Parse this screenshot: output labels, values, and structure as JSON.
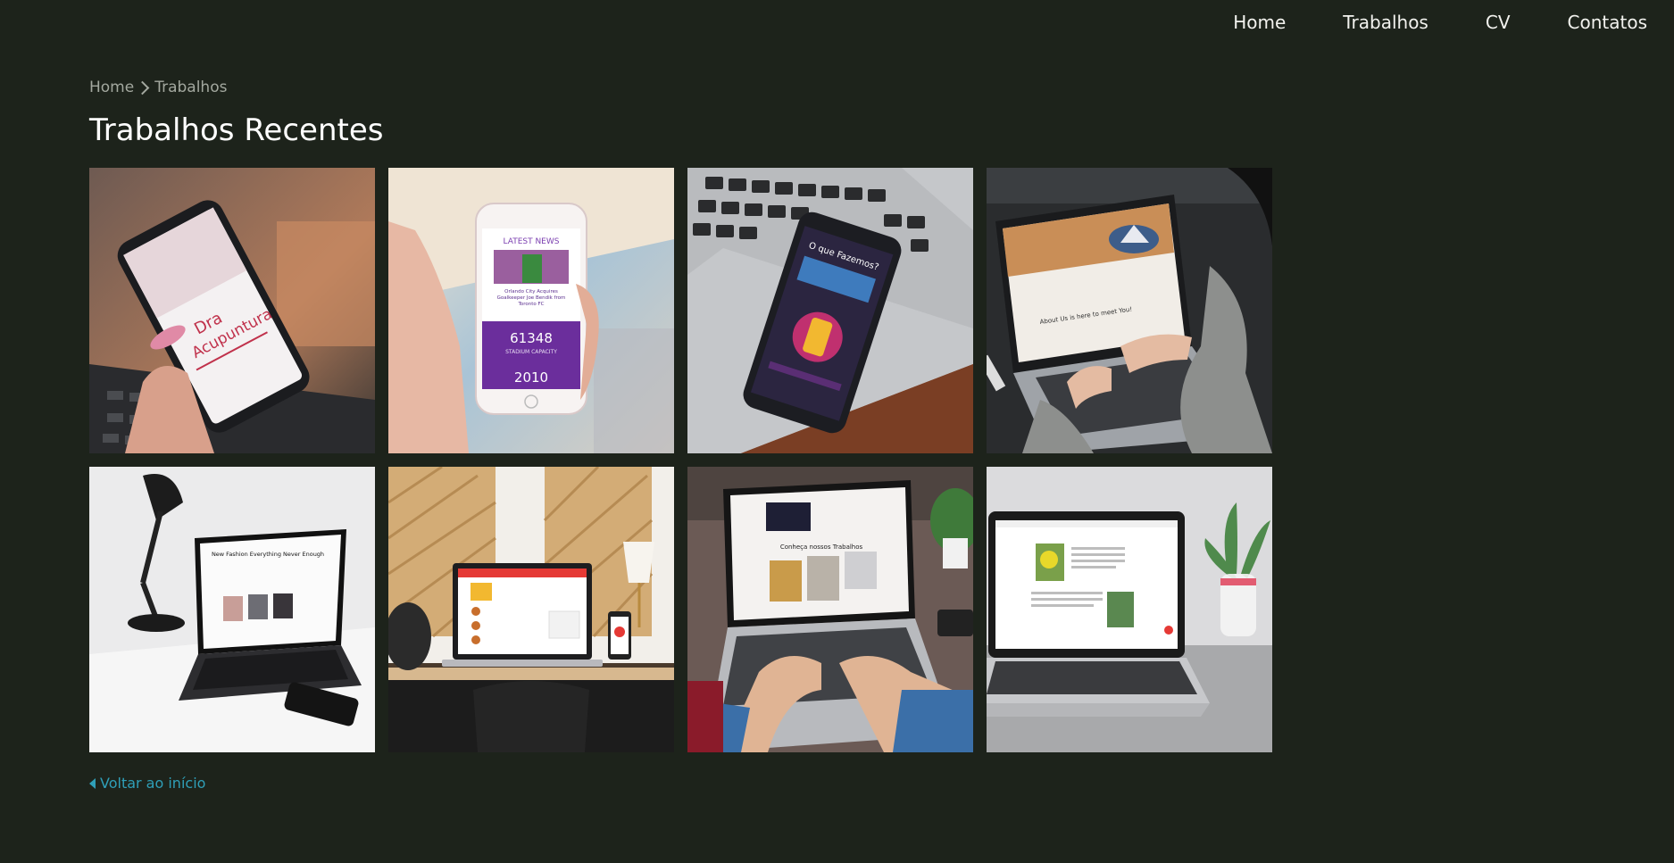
{
  "nav": {
    "items": [
      {
        "label": "Home"
      },
      {
        "label": "Trabalhos"
      },
      {
        "label": "CV"
      },
      {
        "label": "Contatos"
      }
    ]
  },
  "breadcrumb": {
    "home": "Home",
    "current": "Trabalhos"
  },
  "page": {
    "title": "Trabalhos Recentes",
    "back_link": "Voltar ao início"
  },
  "gallery": {
    "tile1": {
      "screen_text_1": "Dra",
      "screen_text_2": "Acupuntura"
    },
    "tile2": {
      "header": "LATEST NEWS",
      "headline_1": "Orlando City Acquires",
      "headline_2": "Goalkeeper Joe Bendik from",
      "headline_3": "Toronto FC",
      "stat_value": "61348",
      "stat_label": "STADIUM CAPACITY",
      "year": "2010"
    },
    "tile3": {
      "screen_title": "O que Fazemos?"
    },
    "tile4": {
      "screen_heading": "About Us is here to meet You!"
    },
    "tile5": {
      "screen_heading": "New Fashion Everything Never Enough"
    },
    "tile7": {
      "screen_heading": "Conheça nossos Trabalhos"
    }
  },
  "colors": {
    "background": "#1d231b",
    "link": "#2f9fb8",
    "muted": "#a3a89f"
  }
}
